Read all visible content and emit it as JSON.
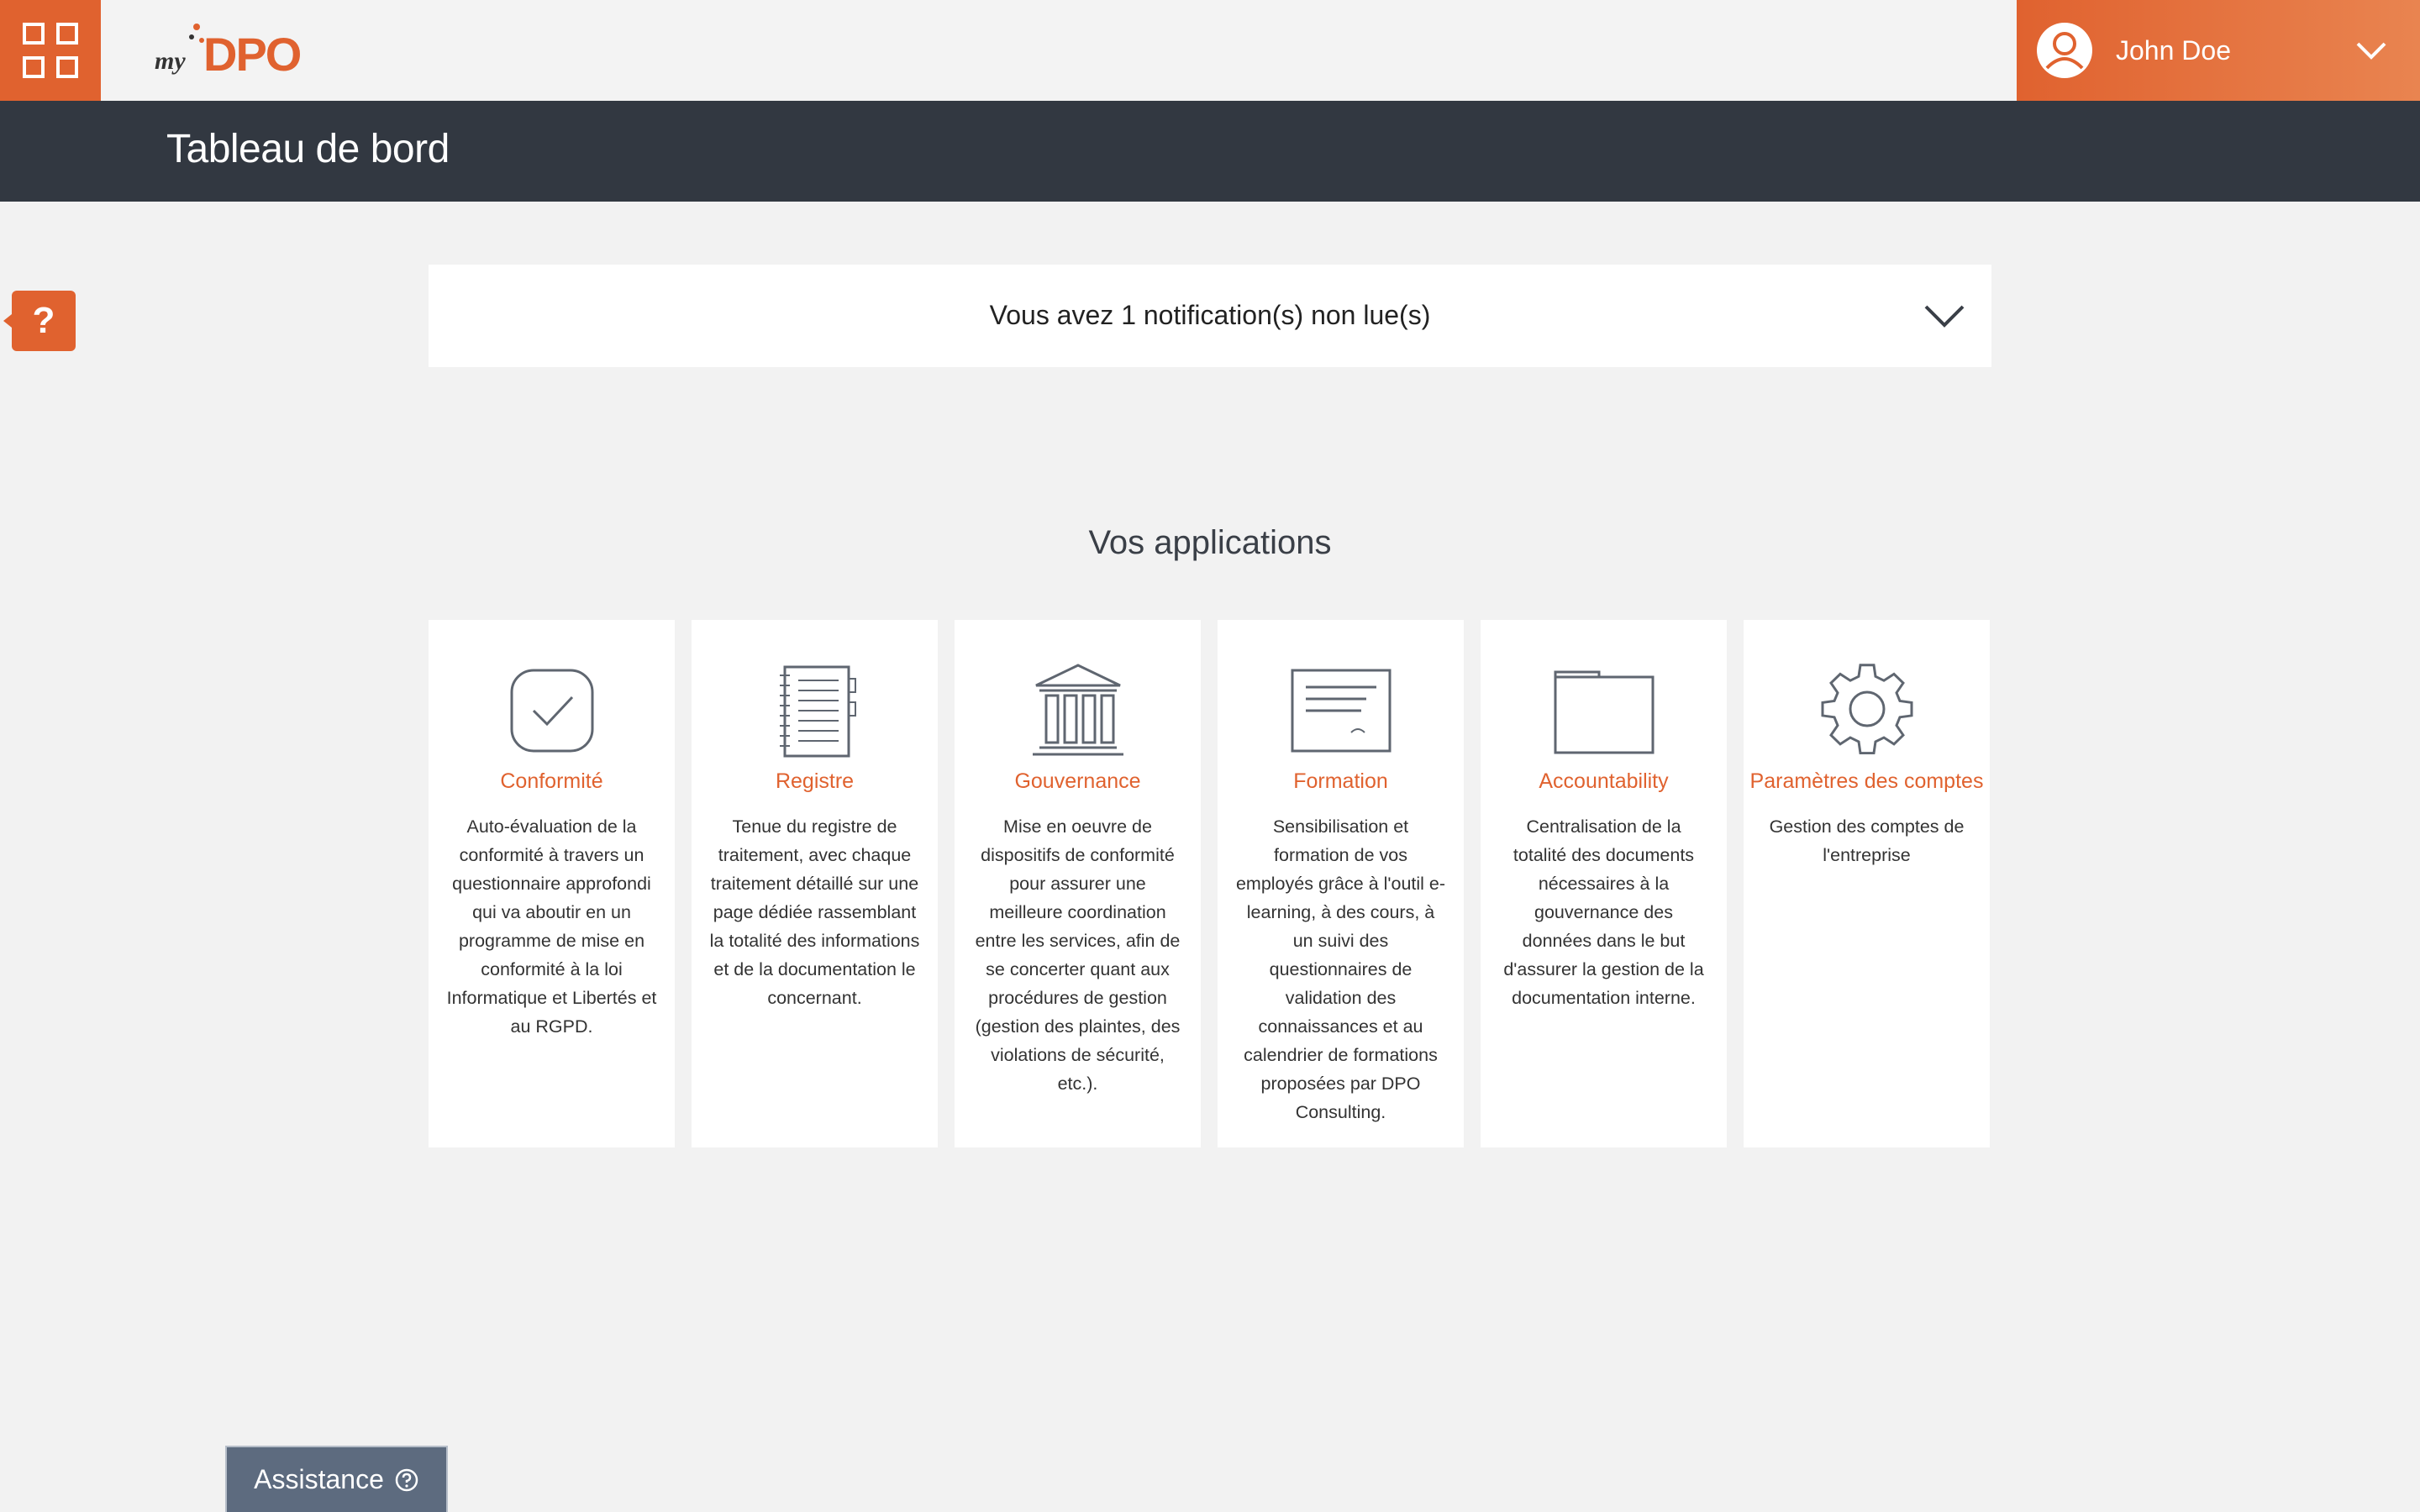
{
  "header": {
    "logo_text_my": "my",
    "logo_text_brand": "DPO",
    "user_name": "John Doe"
  },
  "page": {
    "title": "Tableau de bord"
  },
  "help": {
    "label": "?"
  },
  "notification": {
    "text": "Vous avez 1 notification(s) non lue(s)"
  },
  "applications": {
    "heading": "Vos applications",
    "items": [
      {
        "icon": "check-square-icon",
        "title": "Conformité",
        "description": "Auto-évaluation de la conformité à travers un questionnaire approfondi qui va aboutir en un programme de mise en conformité à la loi Informatique et Libertés et au RGPD."
      },
      {
        "icon": "notebook-icon",
        "title": "Registre",
        "description": "Tenue du registre de traitement, avec chaque traitement détaillé sur une page dédiée rassemblant la totalité des informations et de la documentation le concernant."
      },
      {
        "icon": "institution-icon",
        "title": "Gouvernance",
        "description": "Mise en oeuvre de dispositifs de conformité pour assurer une meilleure coordination entre les services, afin de se concerter quant aux procédures de gestion (gestion des plaintes, des violations de sécurité, etc.)."
      },
      {
        "icon": "certificate-icon",
        "title": "Formation",
        "description": "Sensibilisation et formation de vos employés grâce à l'outil e-learning, à des cours, à un suivi des questionnaires de validation des connaissances et au calendrier de formations proposées par DPO Consulting."
      },
      {
        "icon": "folder-icon",
        "title": "Accountability",
        "description": "Centralisation de la totalité des documents nécessaires à la gouvernance des données dans le but d'assurer la gestion de la documentation interne."
      },
      {
        "icon": "gear-icon",
        "title": "Paramètres des comptes",
        "description": "Gestion des comptes de l'entreprise"
      }
    ]
  },
  "assistance": {
    "label": "Assistance"
  },
  "colors": {
    "accent": "#e0622f",
    "titlebar": "#323841",
    "background": "#f2f2f2",
    "assistance": "#5d6b7f"
  }
}
